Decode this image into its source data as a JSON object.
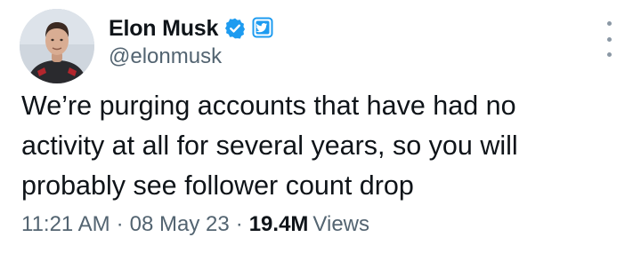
{
  "author": {
    "display_name": "Elon Musk",
    "handle": "@elonmusk",
    "icons": [
      "avatar-photo",
      "verified-badge-icon",
      "affiliate-badge-icon"
    ],
    "colors": {
      "verified": "#1d9bf0",
      "affiliate": "#1d9bf0"
    }
  },
  "tweet": {
    "text": "We’re purging accounts that have had no\nactivity at all for several years, so you will\nprobably see follower count drop"
  },
  "meta": {
    "time": "11:21 AM",
    "separator": "·",
    "date": "08 May 23",
    "views_count": "19.4M",
    "views_label": "Views"
  },
  "menu": {
    "icon": "more-vertical-icon"
  },
  "theme": {
    "text": "#0f1419",
    "secondary_text": "#536471",
    "background": "#ffffff"
  }
}
